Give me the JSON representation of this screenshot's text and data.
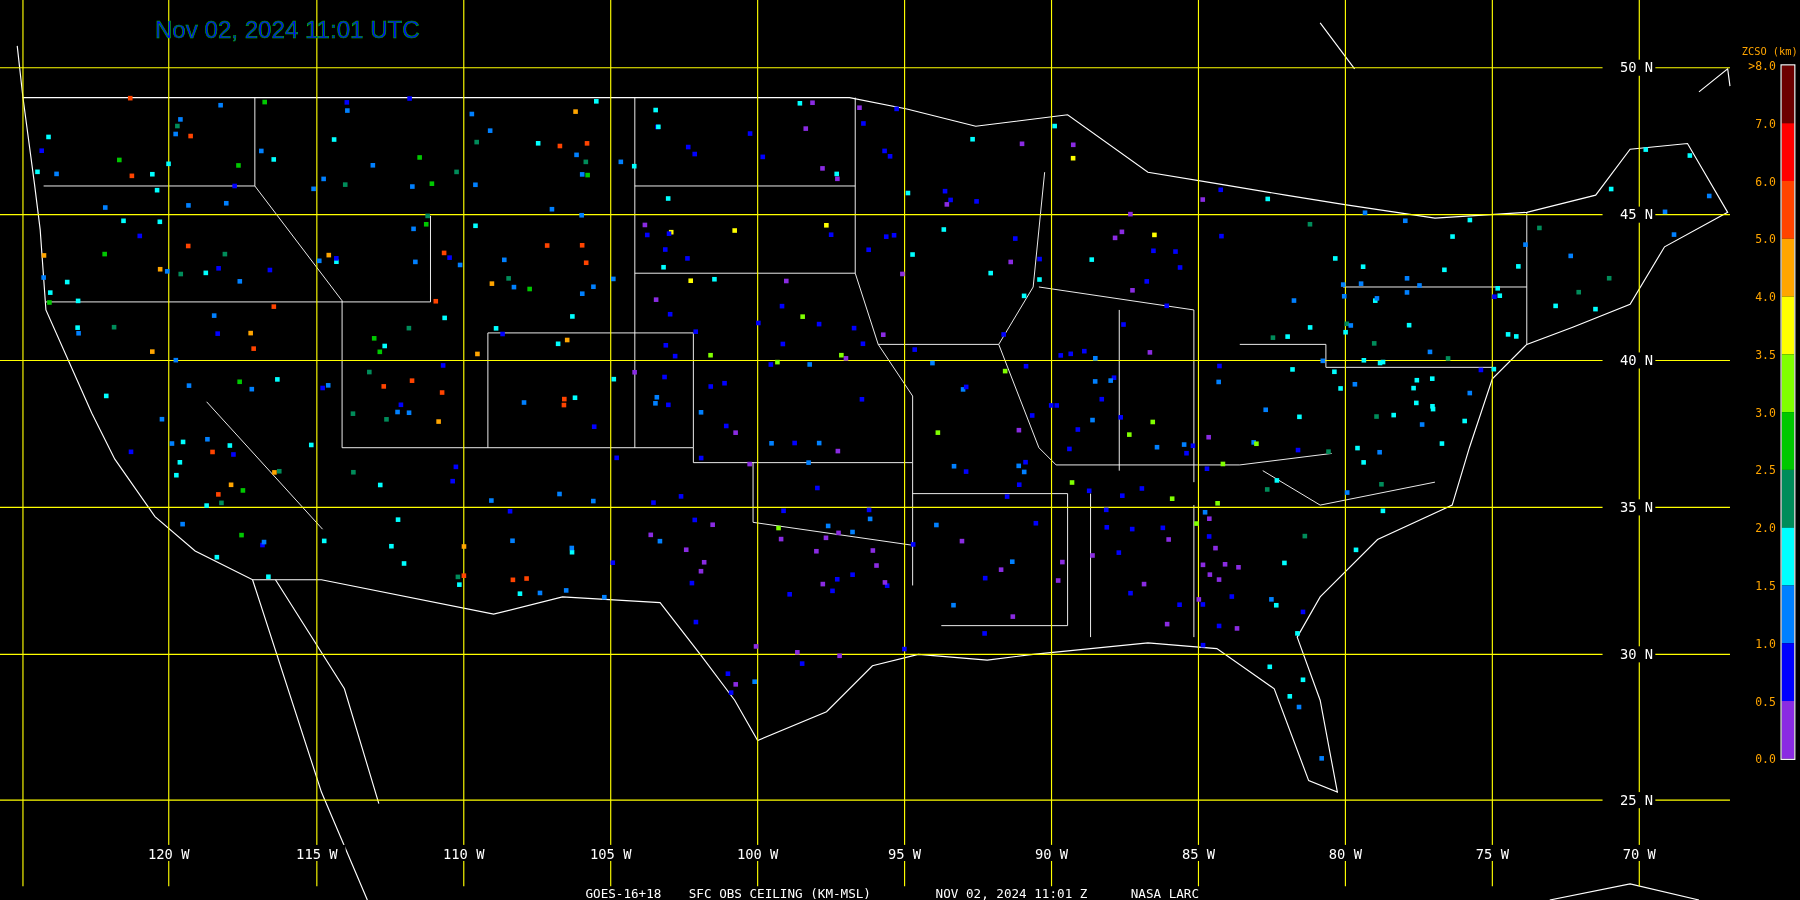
{
  "title": "Nov 02, 2024 11:01 UTC",
  "map": {
    "longitude_labels": [
      "120 W",
      "115 W",
      "110 W",
      "105 W",
      "100 W",
      "95 W",
      "90 W",
      "85 W",
      "80 W",
      "75 W",
      "70 W"
    ],
    "latitude_labels": [
      "50 N",
      "45 N",
      "40 N",
      "35 N",
      "30 N",
      "25 N"
    ]
  },
  "legend": {
    "title": "ZCSO (km)",
    "labels": [
      ">8.0",
      "7.0",
      "6.0",
      "5.0",
      "4.0",
      "3.5",
      "3.0",
      "2.5",
      "2.0",
      "1.5",
      "1.0",
      "0.5",
      "0.0"
    ],
    "segments": [
      {
        "color": "#6b0000"
      },
      {
        "color": "#ff0000"
      },
      {
        "color": "#ff4400"
      },
      {
        "color": "#ffa500"
      },
      {
        "color": "#ffff00"
      },
      {
        "color": "#80ff00"
      },
      {
        "color": "#00c800"
      },
      {
        "color": "#008c5a"
      },
      {
        "color": "#00ffff"
      },
      {
        "color": "#0080ff"
      },
      {
        "color": "#0000ff"
      },
      {
        "color": "#8a2be2"
      }
    ]
  },
  "caption": [
    "GOES-16+18",
    "SFC OBS CEILING (KM-MSL)",
    "NOV 02, 2024 11:01 Z",
    "NASA LARC"
  ]
}
